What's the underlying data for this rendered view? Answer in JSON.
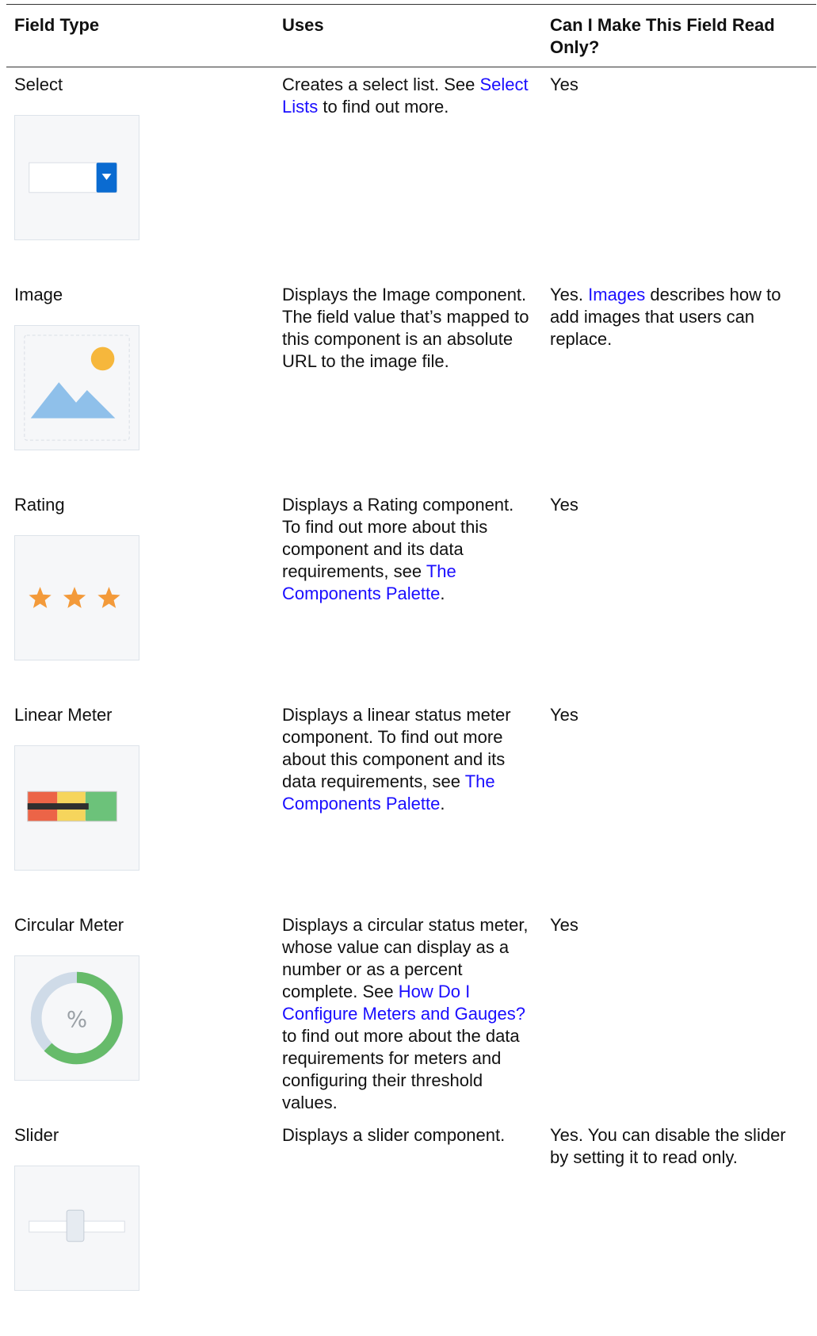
{
  "table": {
    "headers": {
      "field_type": "Field Type",
      "uses": "Uses",
      "read_only": "Can I Make This Field Read Only?"
    },
    "rows": [
      {
        "field_type": "Select",
        "icon": "select-list-icon",
        "uses": [
          {
            "text": "Creates a select list. See "
          },
          {
            "text": "Select Lists",
            "link": true
          },
          {
            "text": " to find out more."
          }
        ],
        "read_only": [
          {
            "text": "Yes"
          }
        ]
      },
      {
        "field_type": "Image",
        "icon": "image-icon",
        "uses": [
          {
            "text": "Displays the Image component. The field value that’s mapped to this component is an absolute URL to the image file."
          }
        ],
        "read_only": [
          {
            "text": "Yes. "
          },
          {
            "text": "Images",
            "link": true
          },
          {
            "text": " describes how to add images that users can replace."
          }
        ]
      },
      {
        "field_type": "Rating",
        "icon": "rating-stars-icon",
        "uses": [
          {
            "text": "Displays a Rating component. To find out more about this component and its data requirements, see "
          },
          {
            "text": "The Components Palette",
            "link": true
          },
          {
            "text": "."
          }
        ],
        "read_only": [
          {
            "text": "Yes"
          }
        ]
      },
      {
        "field_type": "Linear Meter",
        "icon": "linear-meter-icon",
        "uses": [
          {
            "text": "Displays a linear status meter component. To find out more about this component and its data requirements, see "
          },
          {
            "text": "The Components Palette",
            "link": true
          },
          {
            "text": "."
          }
        ],
        "read_only": [
          {
            "text": "Yes"
          }
        ]
      },
      {
        "field_type": "Circular Meter",
        "icon": "circular-meter-icon",
        "icon_text": "%",
        "uses": [
          {
            "text": "Displays a circular status meter, whose value can display as a number or as a percent complete. See "
          },
          {
            "text": "How Do I Configure Meters and Gauges?",
            "link": true
          },
          {
            "text": " to find out more about the data requirements for meters and configuring their threshold values."
          }
        ],
        "read_only": [
          {
            "text": "Yes"
          }
        ]
      },
      {
        "field_type": "Slider",
        "icon": "slider-icon",
        "uses": [
          {
            "text": "Displays a slider component."
          }
        ],
        "read_only": [
          {
            "text": "Yes. You can disable the slider by setting it to read only."
          }
        ]
      }
    ]
  },
  "colors": {
    "link": "#1a0dff",
    "select_button": "#0a6bd1",
    "image_sky_shape": "#8fc0ea",
    "image_sun": "#f6b73c",
    "star": "#f39a3a",
    "meter_red": "#ec6447",
    "meter_yellow": "#f6d55c",
    "meter_green": "#6cc27a",
    "circle_green": "#66bb6a",
    "circle_track": "#cfdbe8"
  }
}
